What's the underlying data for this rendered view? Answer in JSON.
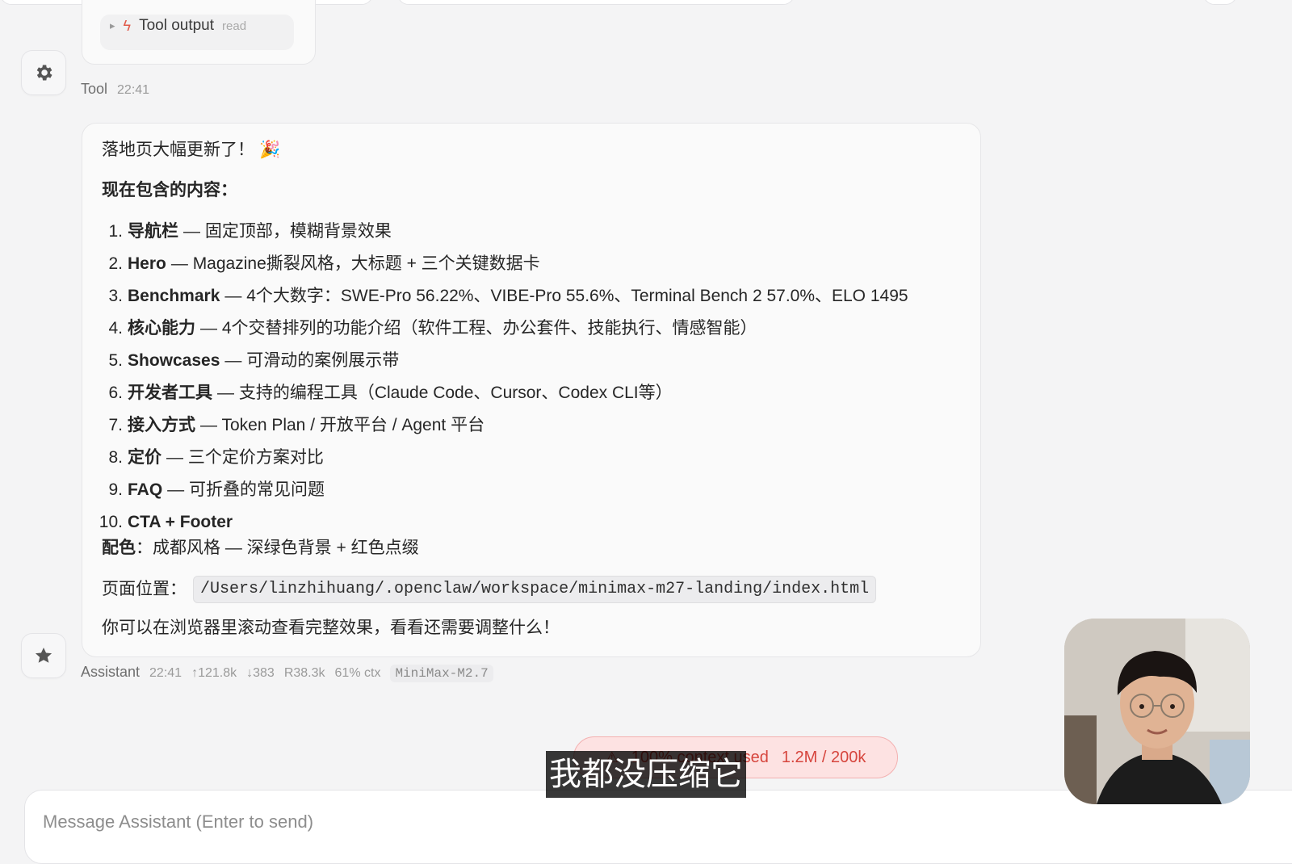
{
  "previous_message": {
    "tool_output_label": "Tool output",
    "tool_output_sub": "read",
    "sender": "Tool",
    "time": "22:41"
  },
  "assistant_message": {
    "title": "落地页大幅更新了！",
    "title_emoji": "🎉",
    "subhead": "现在包含的内容：",
    "items": [
      {
        "num": "1.",
        "name": "导航栏",
        "desc": "— 固定顶部，模糊背景效果"
      },
      {
        "num": "2.",
        "name": "Hero",
        "desc": "— Magazine撕裂风格，大标题 + 三个关键数据卡"
      },
      {
        "num": "3.",
        "name": "Benchmark",
        "desc": "— 4个大数字：SWE-Pro 56.22%、VIBE-Pro 55.6%、Terminal Bench 2 57.0%、ELO 1495"
      },
      {
        "num": "4.",
        "name": "核心能力",
        "desc": "— 4个交替排列的功能介绍（软件工程、办公套件、技能执行、情感智能）"
      },
      {
        "num": "5.",
        "name": "Showcases",
        "desc": "— 可滑动的案例展示带"
      },
      {
        "num": "6.",
        "name": "开发者工具",
        "desc": "— 支持的编程工具（Claude Code、Cursor、Codex CLI等）"
      },
      {
        "num": "7.",
        "name": "接入方式",
        "desc": "— Token Plan / 开放平台 / Agent 平台"
      },
      {
        "num": "8.",
        "name": "定价",
        "desc": "— 三个定价方案对比"
      },
      {
        "num": "9.",
        "name": "FAQ",
        "desc": "— 可折叠的常见问题"
      },
      {
        "num": "10.",
        "name": "CTA + Footer",
        "desc": ""
      }
    ],
    "color_label": "配色",
    "color_desc": "：成都风格 — 深绿色背景 + 红色点缀",
    "path_label": "页面位置：",
    "path_value": "/Users/linzhihuang/.openclaw/workspace/minimax-m27-landing/index.html",
    "closing": "你可以在浏览器里滚动查看完整效果，看看还需要调整什么！",
    "meta": {
      "sender": "Assistant",
      "time": "22:41",
      "tokens_up": "↑121.8k",
      "tokens_down": "↓383",
      "reads": "R38.3k",
      "ctx": "61% ctx",
      "model": "MiniMax-M2.7"
    }
  },
  "context_warning": {
    "icon": "warning-icon",
    "text": "100% context used",
    "usage": "1.2M / 200k"
  },
  "composer": {
    "placeholder": "Message Assistant (Enter to send)"
  },
  "subtitle": "我都没压缩它",
  "colors": {
    "background": "#f4f4f5",
    "bubble": "#fafafa",
    "warning_bg": "#fde2e2",
    "warning_text": "#d6453d"
  }
}
